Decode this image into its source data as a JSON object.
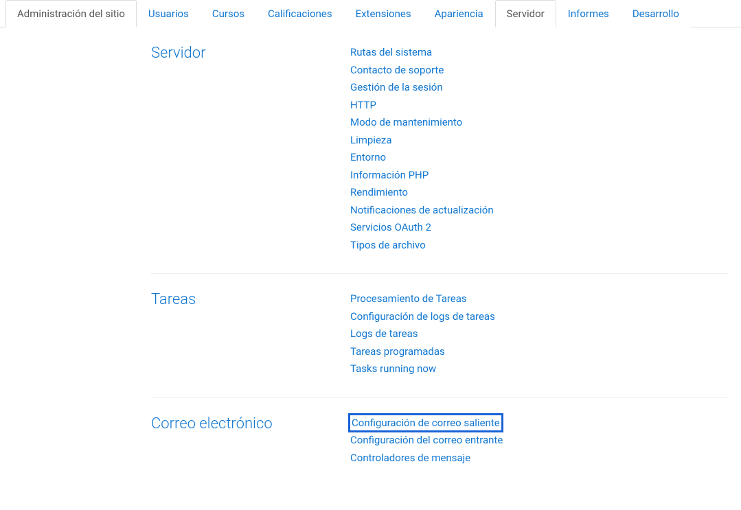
{
  "tabs": [
    {
      "label": "Administración del sitio",
      "type": "first"
    },
    {
      "label": "Usuarios",
      "type": "normal"
    },
    {
      "label": "Cursos",
      "type": "normal"
    },
    {
      "label": "Calificaciones",
      "type": "normal"
    },
    {
      "label": "Extensiones",
      "type": "normal"
    },
    {
      "label": "Apariencia",
      "type": "normal"
    },
    {
      "label": "Servidor",
      "type": "active"
    },
    {
      "label": "Informes",
      "type": "normal"
    },
    {
      "label": "Desarrollo",
      "type": "normal"
    }
  ],
  "sections": [
    {
      "title": "Servidor",
      "links": [
        "Rutas del sistema",
        "Contacto de soporte",
        "Gestión de la sesión",
        "HTTP",
        "Modo de mantenimiento",
        "Limpieza",
        "Entorno",
        "Información PHP",
        "Rendimiento",
        "Notificaciones de actualización",
        "Servicios OAuth 2",
        "Tipos de archivo"
      ]
    },
    {
      "title": "Tareas",
      "links": [
        "Procesamiento de Tareas",
        "Configuración de logs de tareas",
        "Logs de tareas",
        "Tareas programadas",
        "Tasks running now"
      ]
    },
    {
      "title": "Correo electrónico",
      "links": [
        "Configuración de correo saliente",
        "Configuración del correo entrante",
        "Controladores de mensaje"
      ],
      "highlighted_index": 0
    }
  ]
}
